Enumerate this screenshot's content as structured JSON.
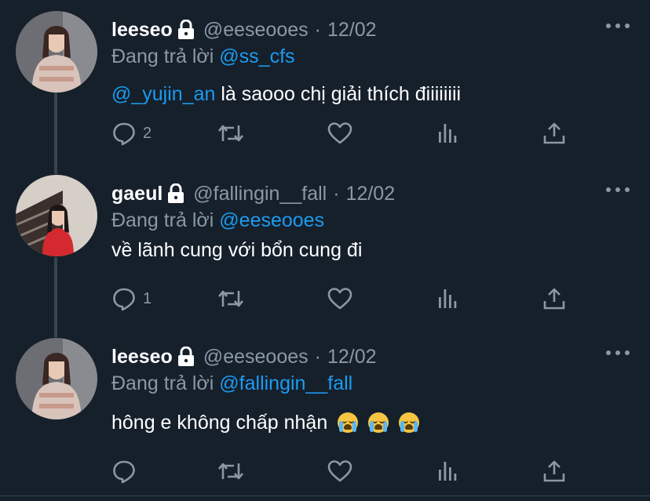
{
  "tweets": [
    {
      "name": "leeseo",
      "handle": "@eeseooes",
      "separator": "·",
      "date": "12/02",
      "reply_prefix": "Đang trả lời ",
      "reply_to": "@ss_cfs",
      "body_mention": "@_yujin_an",
      "body_text": " là saooo chị giải thích điiiiiiii",
      "reply_count": "2",
      "avatar_colors": [
        "#6d6e73",
        "#d9c4bb",
        "#9b6b5c"
      ]
    },
    {
      "name": "gaeul",
      "handle": "@fallingin__fall",
      "separator": "·",
      "date": "12/02",
      "reply_prefix": "Đang trả lời ",
      "reply_to": "@eeseooes",
      "body_mention": "",
      "body_text": "về lãnh cung với bổn cung đi",
      "reply_count": "1",
      "avatar_colors": [
        "#3a2f2c",
        "#d6cfc8",
        "#d42a2f"
      ]
    },
    {
      "name": "leeseo",
      "handle": "@eeseooes",
      "separator": "·",
      "date": "12/02",
      "reply_prefix": "Đang trả lời ",
      "reply_to": "@fallingin__fall",
      "body_mention": "",
      "body_text": "hông e không chấp nhận",
      "body_emojis": [
        "loudly-crying-face",
        "loudly-crying-face",
        "loudly-crying-face"
      ],
      "reply_count": "",
      "avatar_colors": [
        "#6d6e73",
        "#d9c4bb",
        "#9b6b5c"
      ]
    }
  ],
  "icons": {
    "lock": "lock-icon",
    "more": "more-icon",
    "reply": "reply-icon",
    "retweet": "retweet-icon",
    "like": "heart-icon",
    "views": "analytics-icon",
    "share": "share-icon"
  },
  "colors": {
    "background": "#15202b",
    "text": "#ffffff",
    "secondary": "#8b98a5",
    "link": "#1d9bf0",
    "thread_line": "#38444d"
  }
}
